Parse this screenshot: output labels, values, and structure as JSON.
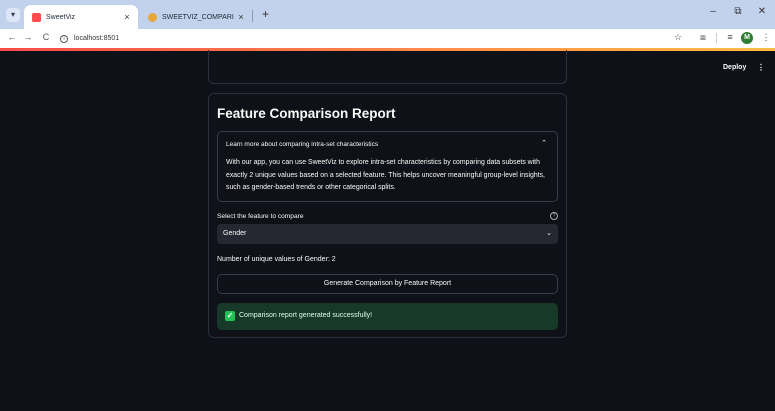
{
  "browser": {
    "tabs": [
      {
        "title": "SweetViz",
        "close": "×"
      },
      {
        "title": "SWEETVIZ_COMPARISON.html",
        "close": "×"
      }
    ],
    "new_tab": "+",
    "menu": "▾",
    "window_controls": {
      "minimize": "–",
      "restore": "⧉",
      "close": "✕"
    },
    "nav": {
      "back": "←",
      "forward": "→",
      "reload": "C"
    },
    "url": "localhost:8501",
    "profile_initial": "M"
  },
  "app": {
    "deploy_label": "Deploy",
    "menu_glyph": "⋮",
    "title": "Feature Comparison Report",
    "expander": {
      "header": "Learn more about comparing intra-set characteristics",
      "body": "With our app, you can use SweetViz to explore intra-set characteristics by comparing data subsets with exactly 2 unique values based on a selected feature. This helps uncover meaningful group-level insights, such as gender-based trends or other categorical splits."
    },
    "select": {
      "label": "Select the feature to compare",
      "value": "Gender"
    },
    "unique_count_text": "Number of unique values of Gender: 2",
    "generate_button": "Generate Comparison by Feature Report",
    "success_message": "Comparison report generated successfully!"
  },
  "colors": {
    "background": "#0e1117",
    "success_bg": "#173928",
    "success_icon": "#21c354",
    "select_bg": "#262730",
    "accent_gradient_start": "#ff4b4b",
    "accent_gradient_end": "#ffbd45"
  },
  "icons": [
    "chrome-menu-icon",
    "streamlit-favicon",
    "sweetviz-favicon",
    "back-icon",
    "forward-icon",
    "reload-icon",
    "site-info-icon",
    "bookmark-star-icon",
    "extensions-icon",
    "sidepanel-icon",
    "profile-avatar",
    "chrome-menu-kebab-icon",
    "chevron-up-icon",
    "help-icon",
    "chevron-down-icon",
    "check-icon"
  ]
}
